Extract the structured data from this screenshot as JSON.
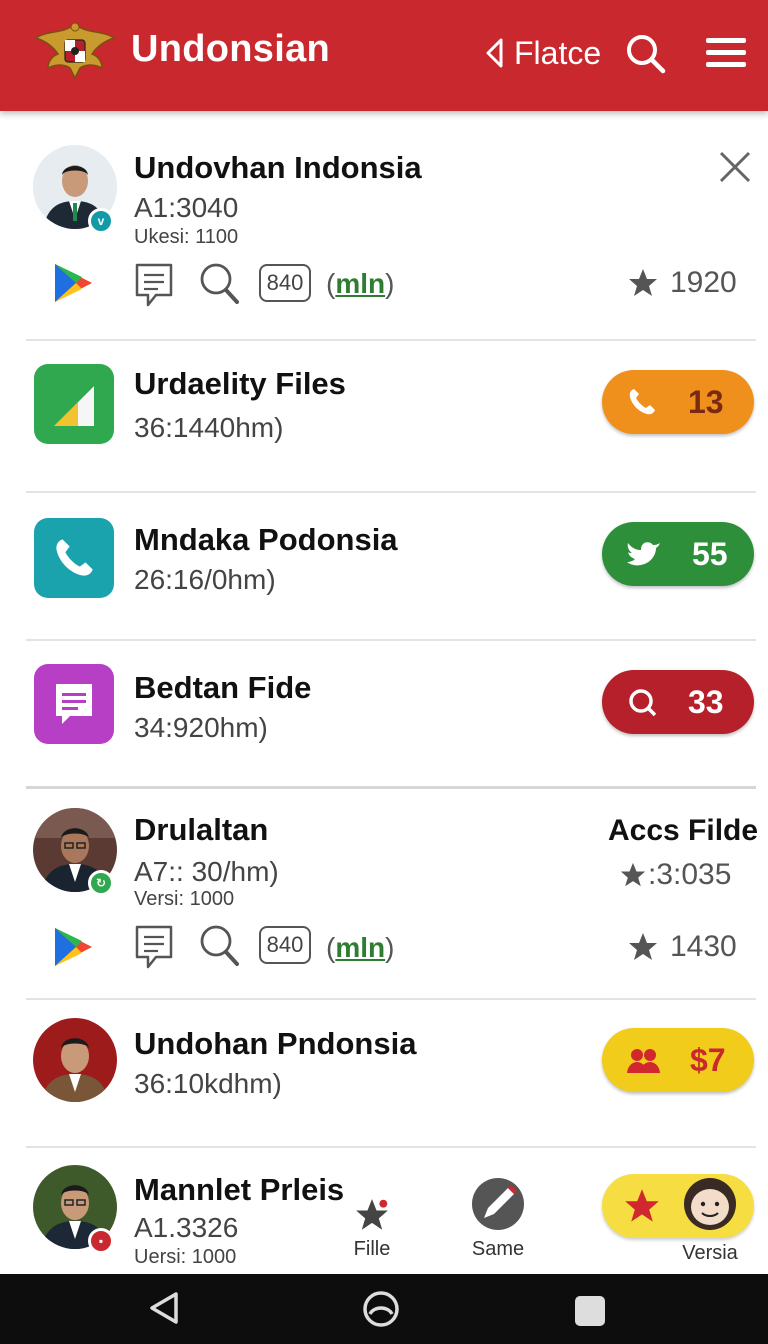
{
  "header": {
    "title": "Undonsian",
    "flatce_label": "Flatce"
  },
  "rows": [
    {
      "title": "Undovhan Indonsia",
      "sub": "A1:3040",
      "small": "Ukesi: 1100",
      "rating": "1920",
      "badge_value": "840",
      "mlnu": "mln"
    },
    {
      "title": "Urdaelity Files",
      "sub": "36:1440hm)",
      "pill": "13",
      "pill_color": "#f0901c"
    },
    {
      "title": "Mndaka Podonsia",
      "sub": "26:16/0hm)",
      "pill": "55",
      "pill_color": "#2e8f3a"
    },
    {
      "title": "Bedtan Fide",
      "sub": "34:920hm)",
      "pill": "33",
      "pill_color": "#b5202a"
    },
    {
      "title": "Drulaltan",
      "sub": "A7:: 30/hm)",
      "small": "Versi: 1000",
      "right_title": "Accs Filde",
      "right_rating": ":3:035",
      "rating": "1430",
      "badge_value": "840",
      "mlnu": "mln"
    },
    {
      "title": "Undohan Pndonsia",
      "sub": "36:10kdhm)",
      "pill": "$7",
      "pill_color": "#f2cc1a"
    },
    {
      "title": "Mannlet Prleis",
      "sub": "A1.3326",
      "small": "Uersi: 1000"
    }
  ],
  "bottom_tabs": [
    {
      "label": "Fille"
    },
    {
      "label": "Same"
    },
    {
      "label": "Versia"
    }
  ],
  "colors": {
    "brand_red": "#c8282e",
    "green": "#2f7d32"
  }
}
